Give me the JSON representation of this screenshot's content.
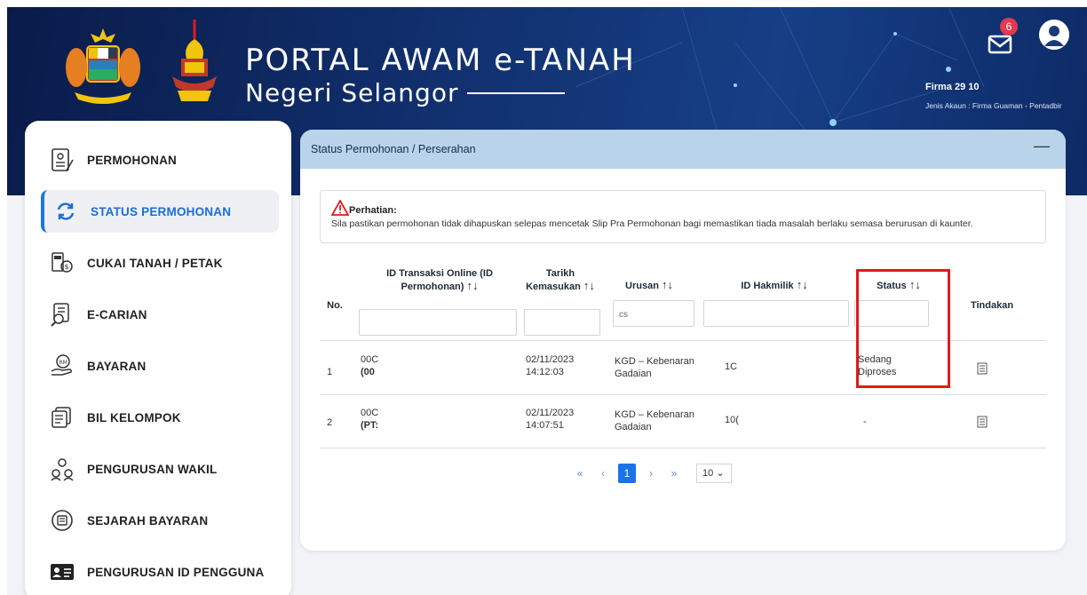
{
  "header": {
    "title_line1": "PORTAL AWAM e-TANAH",
    "title_line2": "Negeri Selangor",
    "notification_count": "6",
    "user_name": "Firma 29 10",
    "account_type": "Jenis Akaun : Firma Guaman - Pentadbir"
  },
  "sidebar": {
    "items": [
      {
        "label": "PERMOHONAN",
        "icon": "form-icon"
      },
      {
        "label": "STATUS PERMOHONAN",
        "icon": "refresh-icon"
      },
      {
        "label": "CUKAI TANAH / PETAK",
        "icon": "tax-icon"
      },
      {
        "label": "E-CARIAN",
        "icon": "search-document-icon"
      },
      {
        "label": "BAYARAN",
        "icon": "payment-icon"
      },
      {
        "label": "BIL KELOMPOK",
        "icon": "bill-icon"
      },
      {
        "label": "PENGURUSAN WAKIL",
        "icon": "people-icon"
      },
      {
        "label": "SEJARAH BAYARAN",
        "icon": "history-icon"
      },
      {
        "label": "PENGURUSAN ID PENGGUNA",
        "icon": "id-card-icon"
      }
    ],
    "active_index": 1
  },
  "card": {
    "title": "Status Permohonan / Perserahan",
    "collapse_symbol": "—"
  },
  "alert": {
    "title": "Perhatian:",
    "body": "Sila pastikan permohonan tidak dihapuskan selepas mencetak Slip Pra Permohonan bagi memastikan tiada masalah berlaku semasa berurusan di kaunter."
  },
  "table": {
    "headers": {
      "no": "No.",
      "id_line1": "ID Transaksi Online (ID",
      "id_line2": "Permohonan)",
      "tarikh_line1": "Tarikh",
      "tarikh_line2": "Kemasukan",
      "urusan": "Urusan",
      "hakmilik": "ID Hakmilik",
      "status": "Status",
      "tindakan": "Tindakan",
      "sort_symbol": "↑↓"
    },
    "filters": {
      "id": "",
      "tarikh": "",
      "urusan": "cs",
      "hakmilik": "",
      "status": ""
    },
    "rows": [
      {
        "no": "1",
        "id_line1": "00C",
        "id_line2": "(00",
        "date": "02/11/2023",
        "time": "14:12:03",
        "urusan_line1": "KGD – Kebenaran",
        "urusan_line2": "Gadaian",
        "hakmilik": "1C",
        "status_line1": "Sedang",
        "status_line2": "Diproses"
      },
      {
        "no": "2",
        "id_line1": "00C",
        "id_line2": "(PT:",
        "date": "02/11/2023",
        "time": "14:07:51",
        "urusan_line1": "KGD – Kebenaran",
        "urusan_line2": "Gadaian",
        "hakmilik": "10(",
        "status_line1": "-",
        "status_line2": ""
      }
    ]
  },
  "pagination": {
    "first": "«",
    "prev": "‹",
    "current": "1",
    "next": "›",
    "last": "»",
    "page_size": "10"
  },
  "colors": {
    "accent": "#1a73e8",
    "highlight_box": "#e31919",
    "card_header": "#b9d3ea",
    "header_bg": "#11306e"
  }
}
